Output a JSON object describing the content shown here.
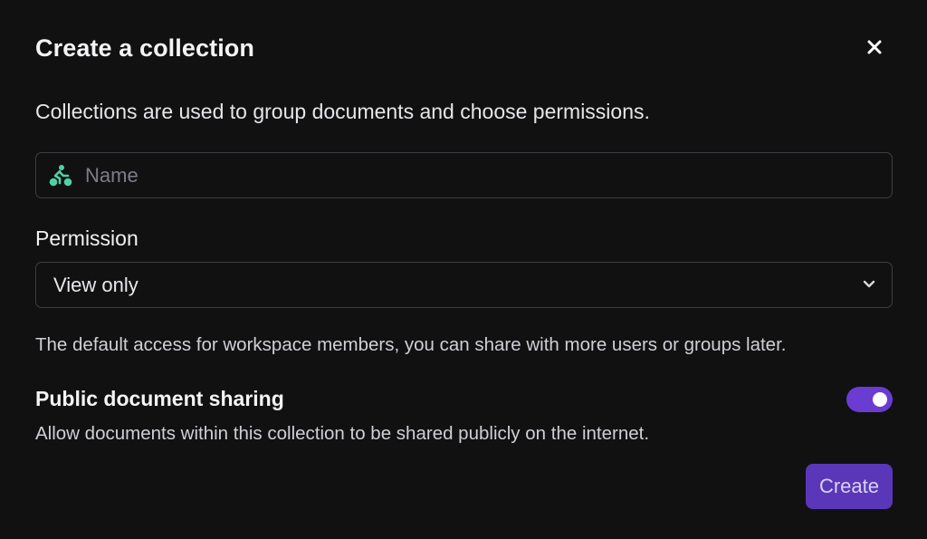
{
  "dialog": {
    "title": "Create a collection",
    "close_icon": "close-icon",
    "description": "Collections are used to group documents and choose permissions."
  },
  "name_field": {
    "icon": "bicycle-rider-icon",
    "icon_color": "#4fd1a5",
    "placeholder": "Name",
    "value": ""
  },
  "permission": {
    "label": "Permission",
    "selected": "View only",
    "chevron_icon": "chevron-down-icon",
    "helper": "The default access for workspace members, you can share with more users or groups later."
  },
  "public_sharing": {
    "title": "Public document sharing",
    "description": "Allow documents within this collection to be shared publicly on the internet.",
    "enabled": true,
    "toggle_color": "#6a3cd2"
  },
  "actions": {
    "create_label": "Create",
    "create_color": "#5a37b8"
  }
}
